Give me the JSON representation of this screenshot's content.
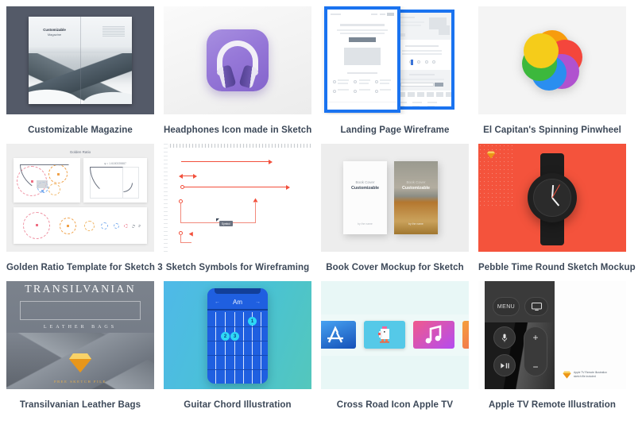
{
  "page": {
    "background": "#ffffff",
    "caption_color": "#3c4858",
    "columns": 4,
    "rows": 3
  },
  "cards": [
    {
      "id": "customizable-magazine",
      "caption": "Customizable Magazine",
      "thumb_bg": "#545a68",
      "art": {
        "kind": "magazine-spread",
        "cover_title": "Customizable",
        "cover_subtitle": "Magazine"
      }
    },
    {
      "id": "headphones-icon",
      "caption": "Headphones Icon made in Sketch",
      "thumb_bg": "#f0f0f0",
      "art": {
        "kind": "app-icon",
        "icon_color": "#9678d8"
      }
    },
    {
      "id": "landing-page-wireframe",
      "caption": "Landing Page Wireframe",
      "thumb_bg": "#ffffff",
      "art": {
        "kind": "wireframe",
        "accent": "#1a73f0"
      }
    },
    {
      "id": "el-capitan-pinwheel",
      "caption": "El Capitan's Spinning Pinwheel",
      "thumb_bg": "#f4f4f4",
      "art": {
        "kind": "pinwheel",
        "colors": [
          "#f79c0e",
          "#f4463c",
          "#b052cf",
          "#2a8ef0",
          "#3cb83c",
          "#f5cc1a"
        ]
      }
    },
    {
      "id": "golden-ratio-template",
      "caption": "Golden Ratio Template for Sketch 3",
      "thumb_bg": "#eeeeee",
      "art": {
        "kind": "golden-ratio",
        "panel_label": "Golden Ratio",
        "equation": "φ = 1.6180339887",
        "circle_colors": [
          "#ef8fa0",
          "#f0a24a",
          "#f0b86a",
          "#5aa0ef",
          "#8fb8ef"
        ]
      }
    },
    {
      "id": "sketch-symbols-wireframing",
      "caption": "Sketch Symbols for Wireframing",
      "thumb_bg": "#ffffff",
      "art": {
        "kind": "sketch-symbols",
        "stroke": "#f2503c",
        "tag_label": "Symbol"
      }
    },
    {
      "id": "book-cover-mockup",
      "caption": "Book Cover Mockup for Sketch",
      "thumb_bg": "#ededed",
      "art": {
        "kind": "book-covers",
        "left_small": "Book Cover",
        "left_title": "Customizable",
        "left_footer": "by the name",
        "right_small": "Book Cover",
        "right_title": "Customizable",
        "right_footer": "by the name"
      }
    },
    {
      "id": "pebble-time-round",
      "caption": "Pebble Time Round Sketch Mockup",
      "thumb_bg": "#f4533c",
      "art": {
        "kind": "watch",
        "case_color": "#202020"
      }
    },
    {
      "id": "transilvanian-leather-bags",
      "caption": "Transilvanian Leather Bags",
      "thumb_bg": "#767d88",
      "art": {
        "kind": "poster",
        "title": "TRANSILVANIAN",
        "subtitle": "LEATHER BAGS",
        "footer": "FREE SKETCH FILE"
      }
    },
    {
      "id": "guitar-chord-illustration",
      "caption": "Guitar Chord Illustration",
      "thumb_bg": "#49c2d4",
      "art": {
        "kind": "chord-diagram",
        "chord": "Am",
        "prev_icon": "←",
        "next_icon": "→",
        "fingers": [
          "1",
          "2",
          "3"
        ]
      }
    },
    {
      "id": "cross-road-icon-apple-tv",
      "caption": "Cross Road Icon Apple TV",
      "thumb_bg": "#e8f7f6",
      "art": {
        "kind": "tv-app-row"
      }
    },
    {
      "id": "apple-tv-remote",
      "caption": "Apple TV Remote Illustration",
      "thumb_bg": "#fdfdfd",
      "art": {
        "kind": "remote",
        "menu_label": "MENU",
        "plus_label": "+",
        "minus_label": "−",
        "credit_line1": "Apple TV Remote Illustration",
        "credit_line2": "sketch file included"
      }
    }
  ]
}
